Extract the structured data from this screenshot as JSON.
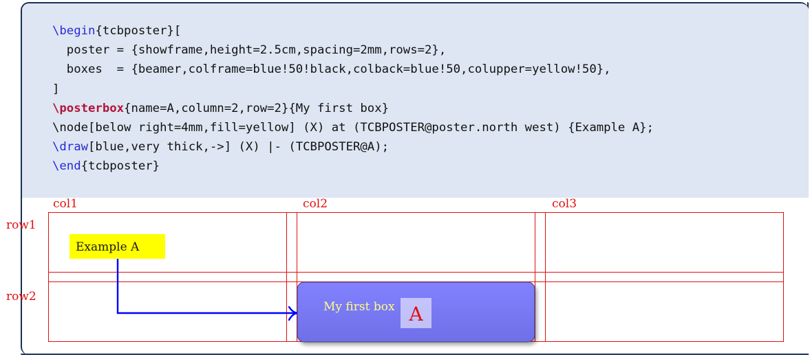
{
  "code": {
    "line1": {
      "macro": "\\begin",
      "rest": "{tcbposter}["
    },
    "line2": "  poster = {showframe,height=2.5cm,spacing=2mm,rows=2},",
    "line3": "  boxes  = {beamer,colframe=blue!50!black,colback=blue!50,colupper=yellow!50},",
    "line4": "]",
    "line5": {
      "macro": "\\posterbox",
      "rest": "{name=A,column=2,row=2}{My first box}"
    },
    "line6": "\\node[below right=4mm,fill=yellow] (X) at (TCBPOSTER@poster.north west) {Example A};",
    "line7": {
      "macro": "\\draw",
      "rest": "[blue,very thick,->] (X) |- (TCBPOSTER@A);"
    },
    "line8": {
      "macro": "\\end",
      "rest": "{tcbposter}"
    }
  },
  "poster": {
    "columns": [
      "col1",
      "col2",
      "col3"
    ],
    "rows": [
      "row1",
      "row2"
    ],
    "node_text": "Example A",
    "box_text": "My first box",
    "box_name": "A"
  },
  "colors": {
    "frame": "#1b2e55",
    "code_background": "#dde6f2",
    "grid": "#e01010",
    "node_fill": "#ffff00",
    "arrow": "#0000ff",
    "box_fill": "#7f7fff",
    "box_frame": "#3f3f80",
    "box_text": "#ffff80"
  }
}
